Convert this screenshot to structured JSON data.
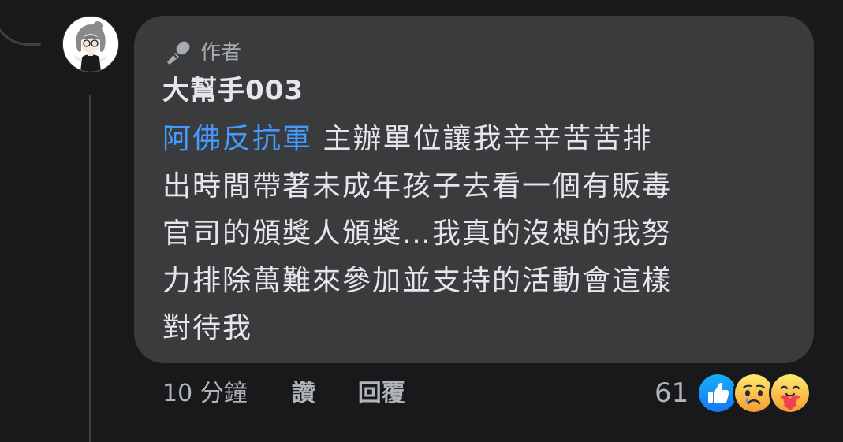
{
  "comment": {
    "badge_label": "作者",
    "author_name": "大幫手003",
    "mention": "阿佛反抗軍",
    "body_line_1": " 主辦單位讓我辛辛苦苦排",
    "body_line_2": "出時間帶著未成年孩子去看一個有販毒",
    "body_line_3": "官司的頒獎人頒獎…我真的沒想的我努",
    "body_line_4": "力排除萬難來參加並支持的活動會這樣",
    "body_line_5": "對待我"
  },
  "actions": {
    "timestamp": "10 分鐘",
    "like_label": "讚",
    "reply_label": "回覆"
  },
  "reactions": {
    "count": "61",
    "icons": [
      "like-icon",
      "sad-icon",
      "care-icon"
    ]
  },
  "colors": {
    "page_background": "#18191a",
    "bubble_background": "#3a3b3c",
    "text_primary": "#e4e6eb",
    "text_secondary": "#b0b3b8",
    "mention": "#4599ff",
    "like_blue": "#1877f2"
  }
}
